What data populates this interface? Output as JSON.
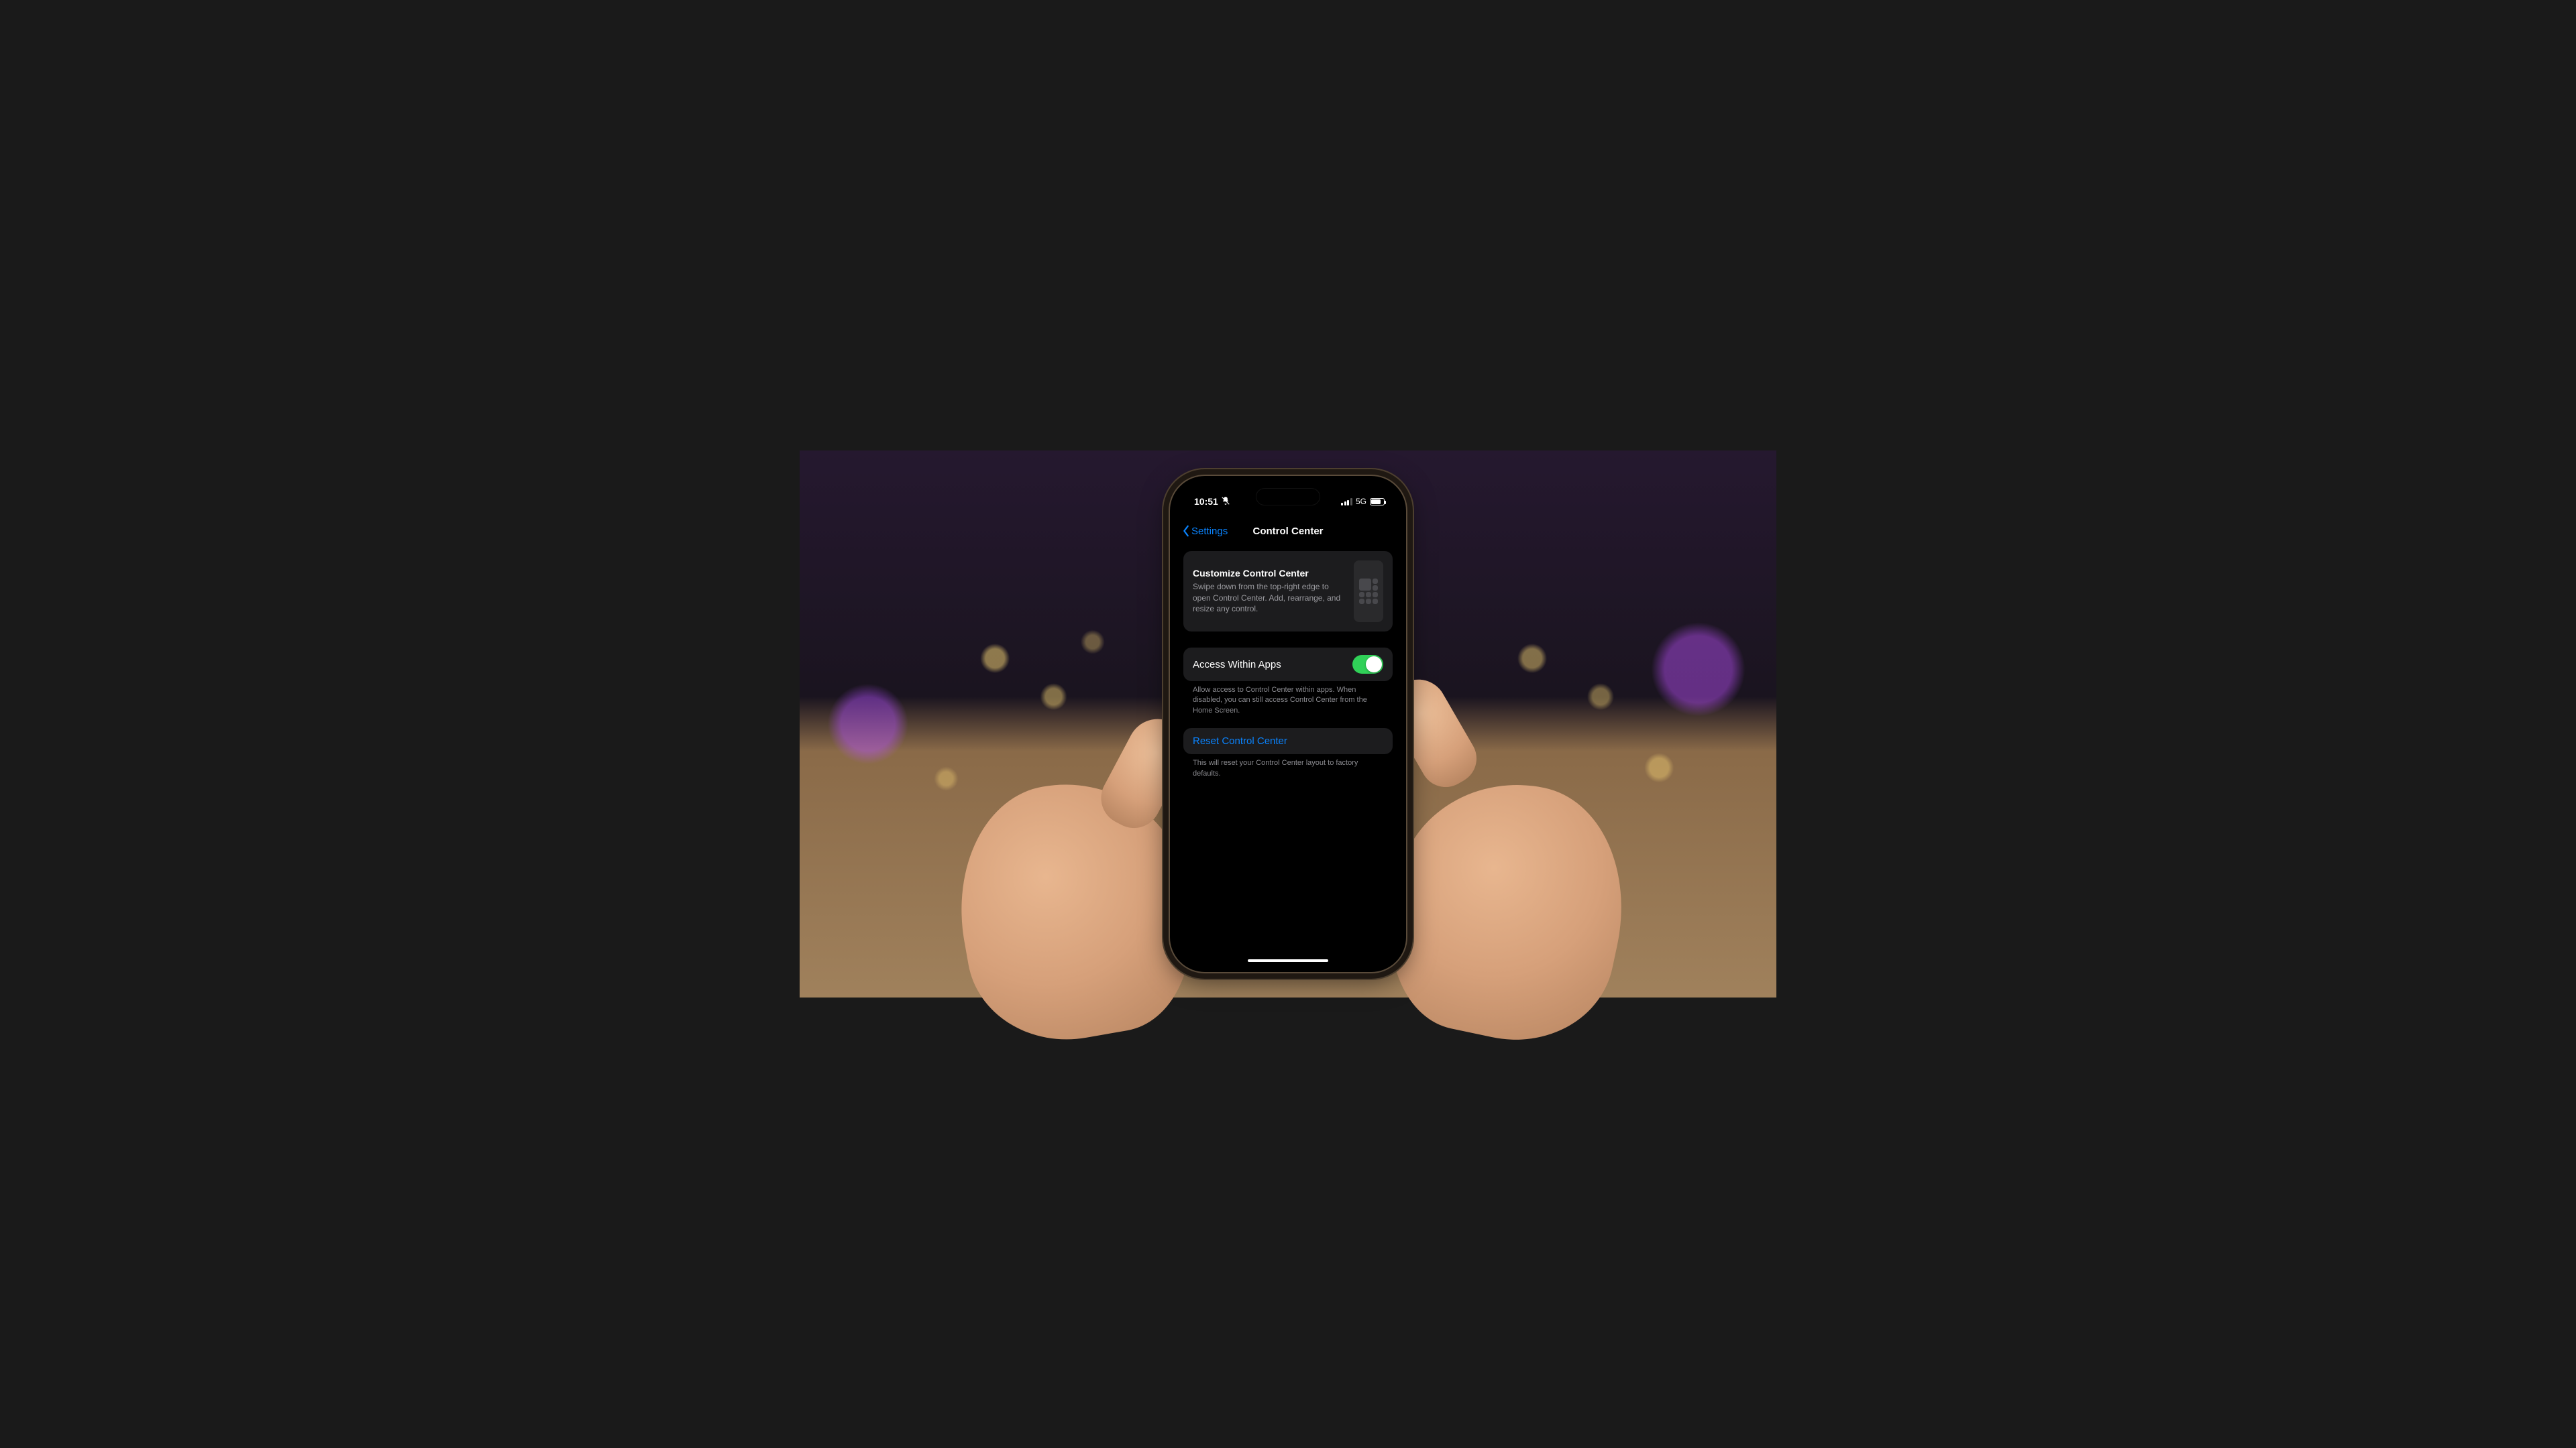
{
  "status": {
    "time": "10:51",
    "network_label": "5G"
  },
  "nav": {
    "back_label": "Settings",
    "title": "Control Center"
  },
  "customize_card": {
    "title": "Customize Control Center",
    "description": "Swipe down from the top-right edge to open Control Center. Add, rearrange, and resize any control."
  },
  "access_section": {
    "label": "Access Within Apps",
    "toggle_on": true,
    "footer": "Allow access to Control Center within apps. When disabled, you can still access Control Center from the Home Screen."
  },
  "reset_section": {
    "label": "Reset Control Center",
    "footer": "This will reset your Control Center layout to factory defaults."
  },
  "colors": {
    "link": "#0a84ff",
    "toggle_on": "#30d158",
    "cell_bg": "#1c1c1e"
  }
}
